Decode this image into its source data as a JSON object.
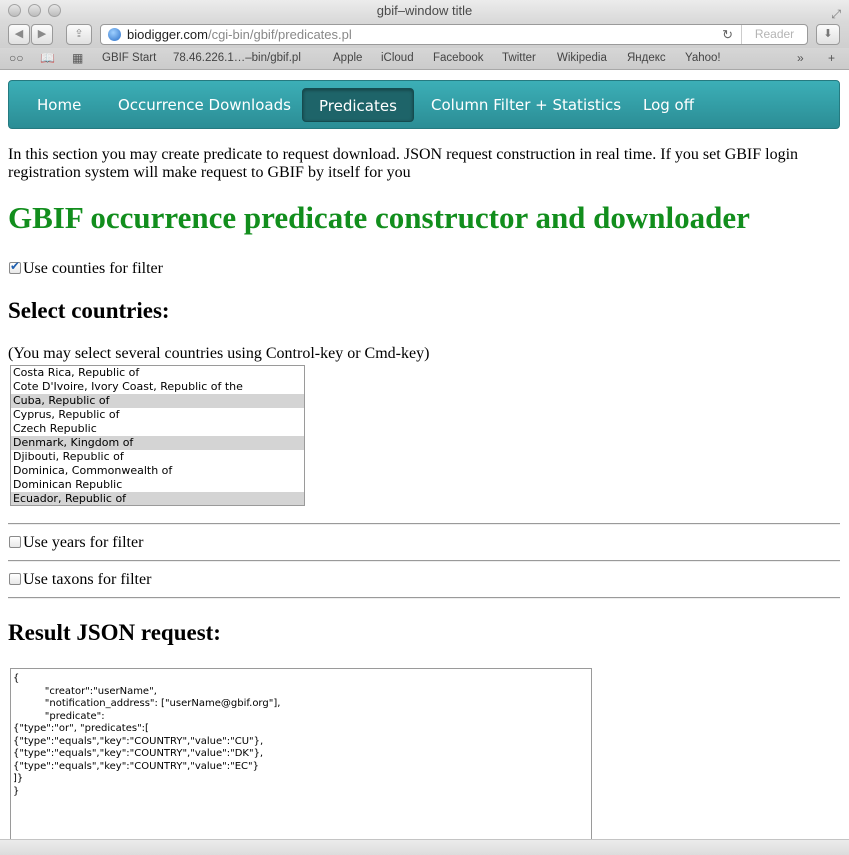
{
  "browser": {
    "window_title": "gbif–window title",
    "url_host": "biodigger.com",
    "url_path": "/cgi-bin/gbif/predicates.pl",
    "reader_label": "Reader",
    "bookmarks": [
      "GBIF Start",
      "78.46.226.1…–bin/gbif.pl",
      "Apple",
      "iCloud",
      "Facebook",
      "Twitter",
      "Wikipedia",
      "Яндекс",
      "Yahoo!"
    ]
  },
  "nav": {
    "items": [
      {
        "label": "Home"
      },
      {
        "label": "Occurrence Downloads"
      },
      {
        "label": "Predicates"
      },
      {
        "label": "Column Filter + Statistics"
      },
      {
        "label": "Log off"
      }
    ],
    "active": "Predicates"
  },
  "intro": "In this section you may create predicate to request download. JSON request construction in real time. If you set GBIF login registration system will make request to GBIF by itself for you",
  "title": "GBIF occurrence predicate constructor and downloader",
  "filters": {
    "counties": {
      "label": "Use counties for filter",
      "checked": true
    },
    "years": {
      "label": "Use years for filter",
      "checked": false
    },
    "taxons": {
      "label": "Use taxons for filter",
      "checked": false
    }
  },
  "countries": {
    "heading": "Select countries:",
    "hint": "(You may select several countries using Control-key or Cmd-key)",
    "options": [
      {
        "label": "Costa Rica, Republic of",
        "selected": false
      },
      {
        "label": "Cote D'Ivoire, Ivory Coast, Republic of the",
        "selected": false
      },
      {
        "label": "Cuba, Republic of",
        "selected": true
      },
      {
        "label": "Cyprus, Republic of",
        "selected": false
      },
      {
        "label": "Czech Republic",
        "selected": false
      },
      {
        "label": "Denmark, Kingdom of",
        "selected": true
      },
      {
        "label": "Djibouti, Republic of",
        "selected": false
      },
      {
        "label": "Dominica, Commonwealth of",
        "selected": false
      },
      {
        "label": "Dominican Republic",
        "selected": false
      },
      {
        "label": "Ecuador, Republic of",
        "selected": true
      }
    ]
  },
  "result": {
    "heading": "Result JSON request:",
    "json_text": "{\n          \"creator\":\"userName\",\n          \"notification_address\": [\"userName@gbif.org\"],\n          \"predicate\":\n{\"type\":\"or\", \"predicates\":[\n{\"type\":\"equals\",\"key\":\"COUNTRY\",\"value\":\"CU\"},\n{\"type\":\"equals\",\"key\":\"COUNTRY\",\"value\":\"DK\"},\n{\"type\":\"equals\",\"key\":\"COUNTRY\",\"value\":\"EC\"}\n]}\n}"
  },
  "colors": {
    "nav_bg": "#3cafb7",
    "title_green": "#128e1d"
  }
}
